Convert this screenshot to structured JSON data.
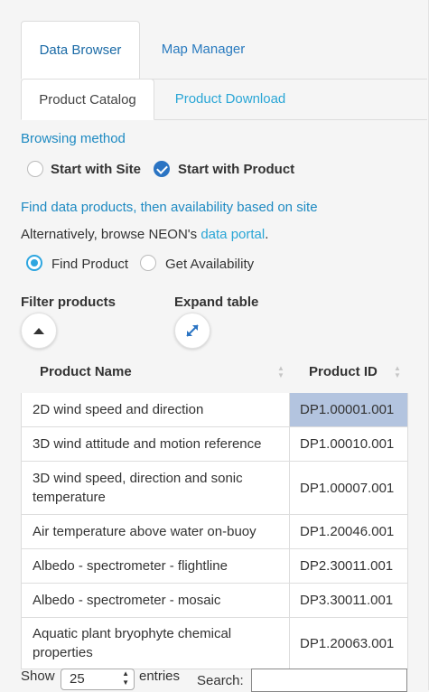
{
  "tabs": [
    {
      "label": "Data Browser",
      "active": true
    },
    {
      "label": "Map Manager",
      "active": false
    }
  ],
  "subtabs": [
    {
      "label": "Product Catalog",
      "active": true
    },
    {
      "label": "Product Download",
      "active": false
    }
  ],
  "browsing": {
    "heading": "Browsing method",
    "options": [
      {
        "label": "Start with Site",
        "checked": false
      },
      {
        "label": "Start with Product",
        "checked": true
      }
    ]
  },
  "find": {
    "heading": "Find data products, then availability based on site",
    "alt_prefix": "Alternatively, browse NEON's ",
    "alt_link": "data portal",
    "alt_suffix": ".",
    "options": [
      {
        "label": "Find Product",
        "checked": true
      },
      {
        "label": "Get Availability",
        "checked": false
      }
    ]
  },
  "controls": {
    "filter_label": "Filter products",
    "expand_label": "Expand table"
  },
  "table": {
    "headers": [
      "Product Name",
      "Product ID"
    ],
    "rows": [
      {
        "name": "2D wind speed and direction",
        "id": "DP1.00001.001",
        "selected": true
      },
      {
        "name": "3D wind attitude and motion reference",
        "id": "DP1.00010.001"
      },
      {
        "name": "3D wind speed, direction and sonic temperature",
        "id": "DP1.00007.001"
      },
      {
        "name": "Air temperature above water on-buoy",
        "id": "DP1.20046.001"
      },
      {
        "name": "Albedo - spectrometer - flightline",
        "id": "DP2.30011.001"
      },
      {
        "name": "Albedo - spectrometer - mosaic",
        "id": "DP3.30011.001"
      },
      {
        "name": "Aquatic plant bryophyte chemical properties",
        "id": "DP1.20063.001"
      }
    ]
  },
  "footer": {
    "show_label": "Show",
    "entries_value": "25",
    "entries_label": "entries",
    "search_label": "Search:",
    "search_value": ""
  },
  "colors": {
    "accent": "#2aa6d6",
    "selected_cell": "#b3c4df",
    "checkbox": "#2b74c3"
  }
}
